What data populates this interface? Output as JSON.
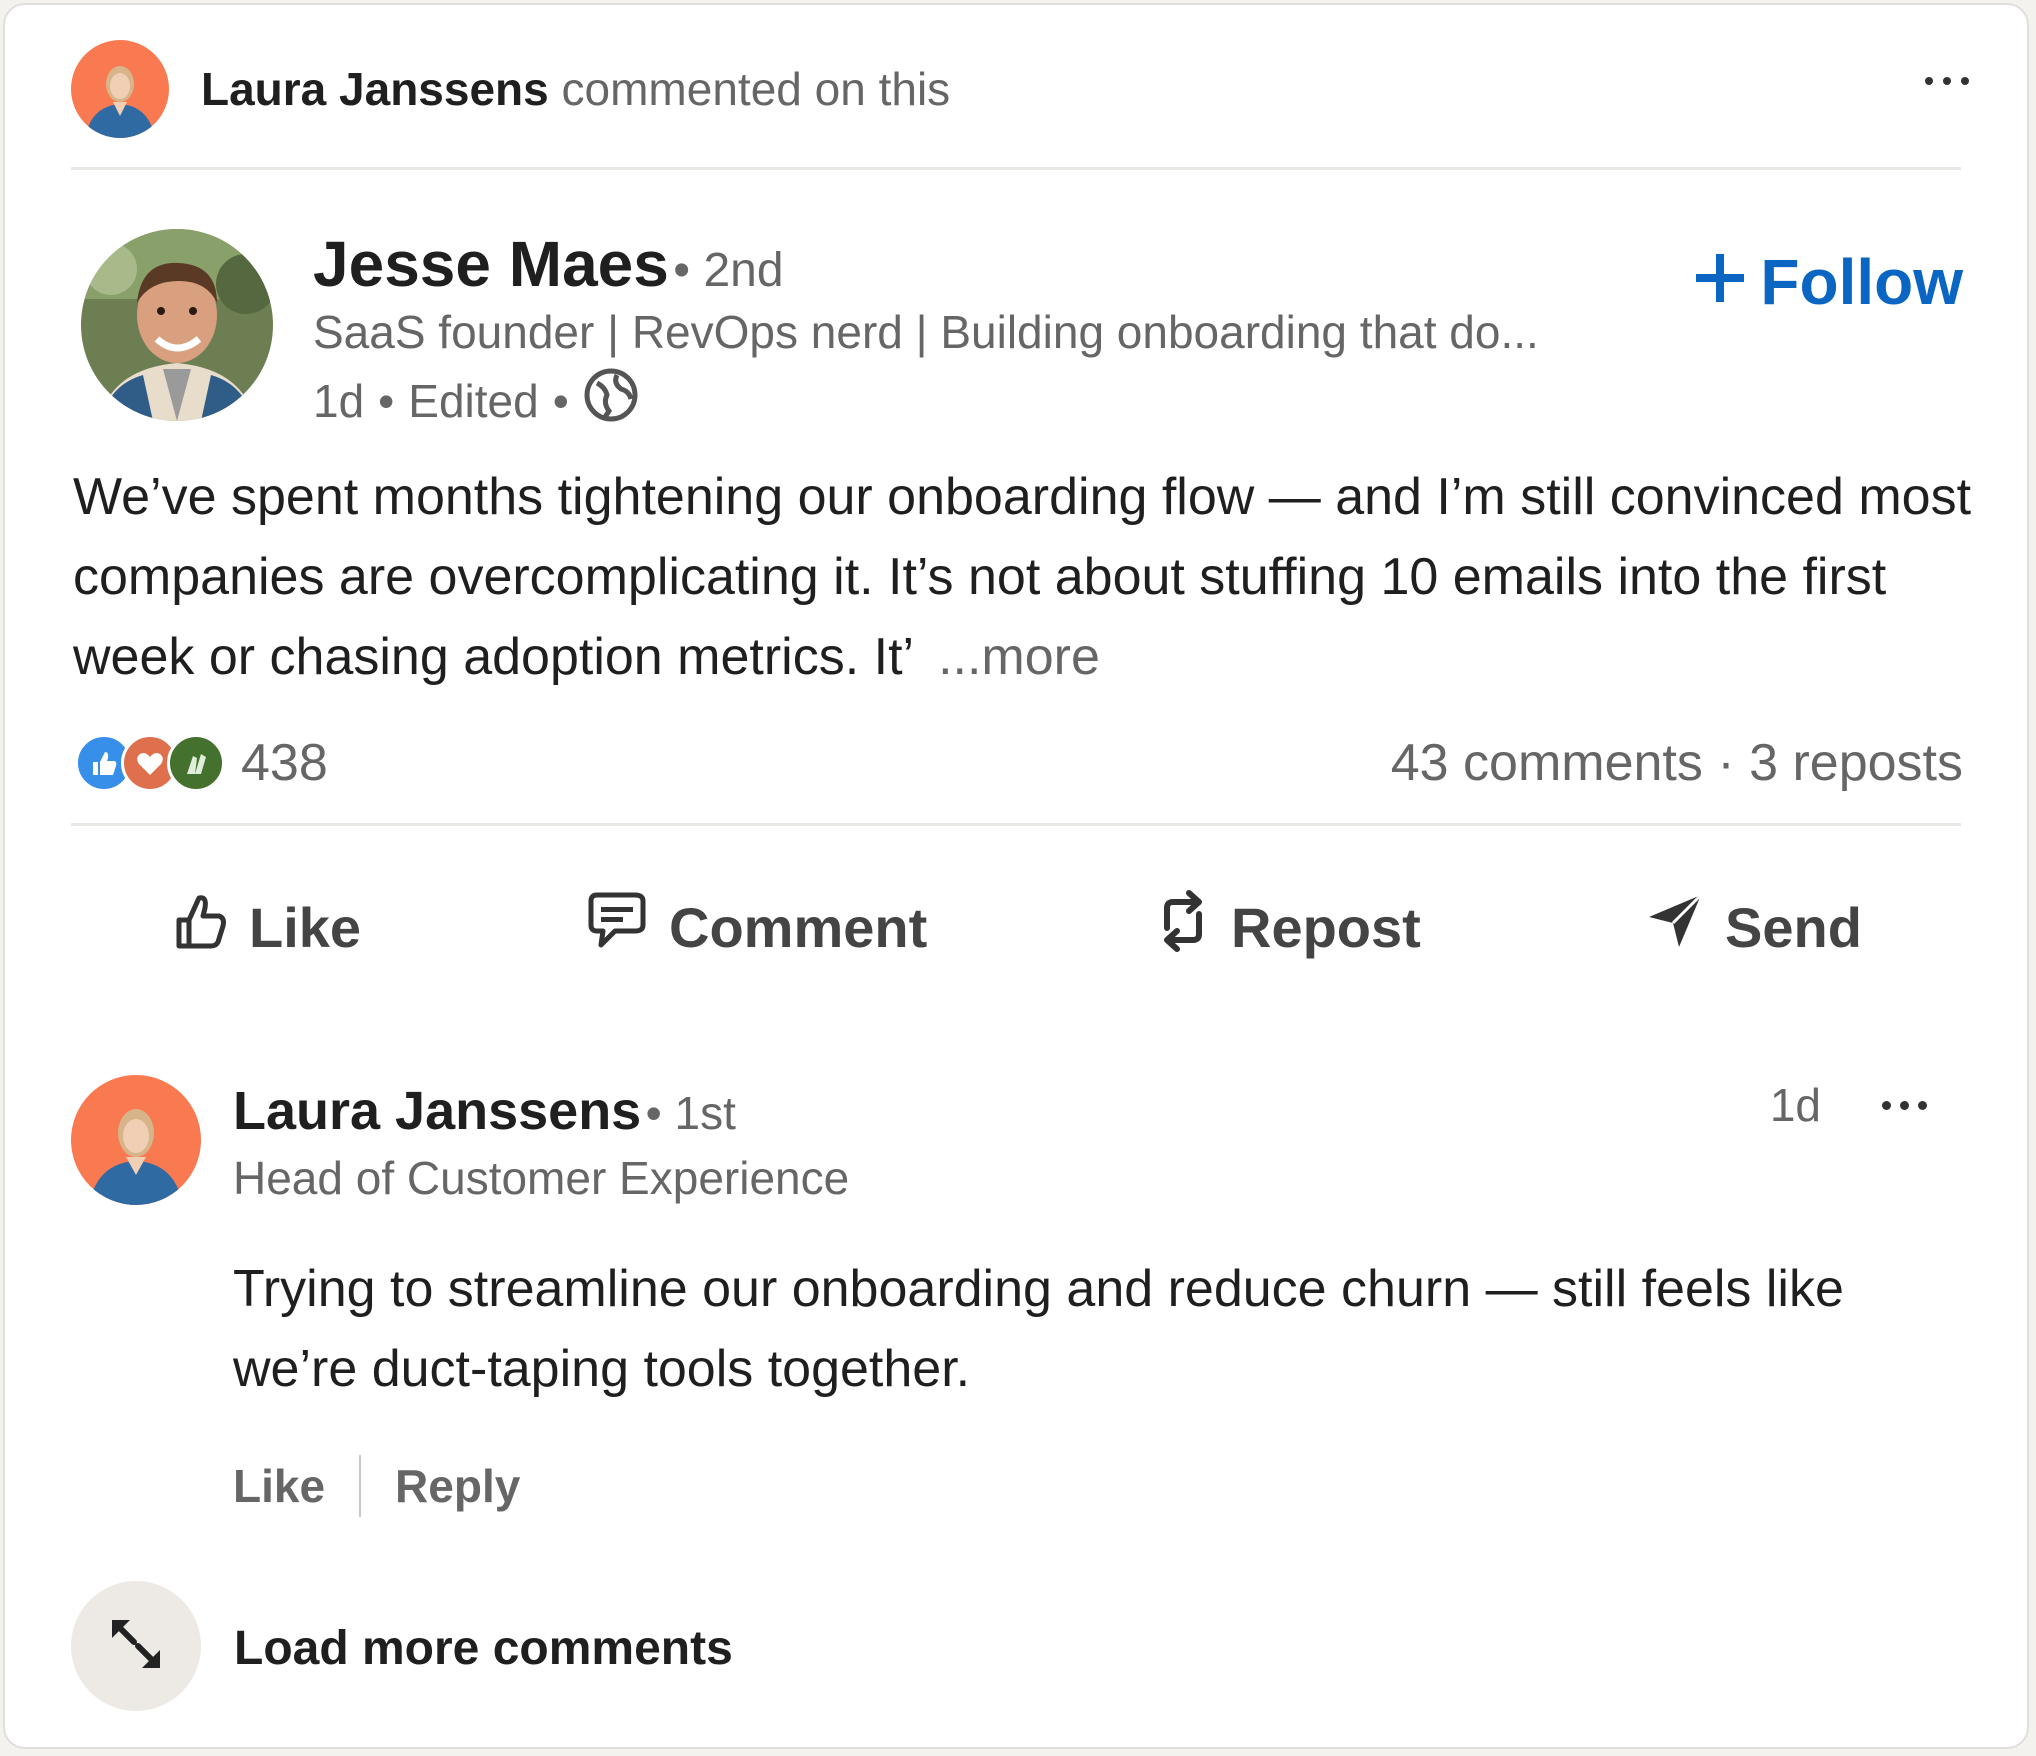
{
  "header": {
    "commenter_name": "Laura Janssens",
    "action_text": "commented on this"
  },
  "post": {
    "author_name": "Jesse Maes",
    "degree": "• 2nd",
    "headline": "SaaS founder | RevOps nerd | Building onboarding that do...",
    "time": "1d",
    "edited": "Edited",
    "follow_label": "Follow",
    "text": "We’ve spent months tightening our onboarding flow — and I’m still convinced most companies are overcomplicating it. It’s not about stuffing 10 emails into the first week or chasing adoption metrics. It’",
    "more_label": "...more",
    "reaction_count": "438",
    "comments_count": "43 comments",
    "reposts_count": "3 reposts",
    "separator": " · "
  },
  "actions": {
    "like": "Like",
    "comment": "Comment",
    "repost": "Repost",
    "send": "Send"
  },
  "comment": {
    "author_name": "Laura Janssens",
    "degree": "• 1st",
    "headline": "Head of Customer Experience",
    "time": "1d",
    "text": "Trying to streamline our onboarding and reduce churn — still feels like we’re duct-taping tools together.",
    "like_label": "Like",
    "reply_label": "Reply"
  },
  "load_more": {
    "label": "Load more comments"
  },
  "colors": {
    "accent": "#0a66c2",
    "like_reaction": "#378fe9",
    "love_reaction": "#df704d",
    "celebrate_reaction": "#44712e",
    "avatar_orange": "#f97a51"
  },
  "icons": {
    "reactions": [
      "like-reaction-icon",
      "love-reaction-icon",
      "celebrate-reaction-icon"
    ],
    "actions": [
      "thumbs-up-icon",
      "speech-bubble-icon",
      "repost-arrows-icon",
      "paper-plane-icon"
    ],
    "load_more": "expand-arrows-icon",
    "visibility": "globe-icon"
  }
}
